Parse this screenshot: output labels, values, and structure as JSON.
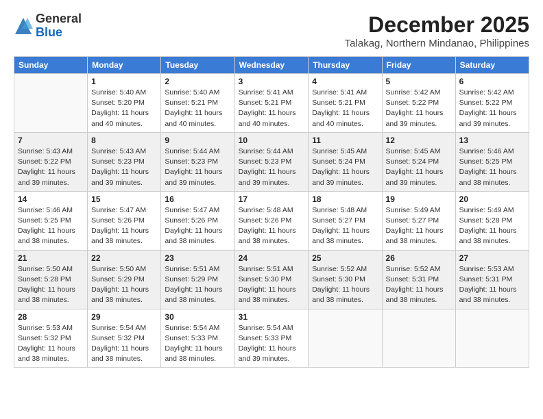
{
  "logo": {
    "general": "General",
    "blue": "Blue"
  },
  "title": {
    "month_year": "December 2025",
    "location": "Talakag, Northern Mindanao, Philippines"
  },
  "headers": [
    "Sunday",
    "Monday",
    "Tuesday",
    "Wednesday",
    "Thursday",
    "Friday",
    "Saturday"
  ],
  "weeks": [
    [
      {
        "day": "",
        "info": ""
      },
      {
        "day": "1",
        "info": "Sunrise: 5:40 AM\nSunset: 5:20 PM\nDaylight: 11 hours\nand 40 minutes."
      },
      {
        "day": "2",
        "info": "Sunrise: 5:40 AM\nSunset: 5:21 PM\nDaylight: 11 hours\nand 40 minutes."
      },
      {
        "day": "3",
        "info": "Sunrise: 5:41 AM\nSunset: 5:21 PM\nDaylight: 11 hours\nand 40 minutes."
      },
      {
        "day": "4",
        "info": "Sunrise: 5:41 AM\nSunset: 5:21 PM\nDaylight: 11 hours\nand 40 minutes."
      },
      {
        "day": "5",
        "info": "Sunrise: 5:42 AM\nSunset: 5:22 PM\nDaylight: 11 hours\nand 39 minutes."
      },
      {
        "day": "6",
        "info": "Sunrise: 5:42 AM\nSunset: 5:22 PM\nDaylight: 11 hours\nand 39 minutes."
      }
    ],
    [
      {
        "day": "7",
        "info": "Sunrise: 5:43 AM\nSunset: 5:22 PM\nDaylight: 11 hours\nand 39 minutes."
      },
      {
        "day": "8",
        "info": "Sunrise: 5:43 AM\nSunset: 5:23 PM\nDaylight: 11 hours\nand 39 minutes."
      },
      {
        "day": "9",
        "info": "Sunrise: 5:44 AM\nSunset: 5:23 PM\nDaylight: 11 hours\nand 39 minutes."
      },
      {
        "day": "10",
        "info": "Sunrise: 5:44 AM\nSunset: 5:23 PM\nDaylight: 11 hours\nand 39 minutes."
      },
      {
        "day": "11",
        "info": "Sunrise: 5:45 AM\nSunset: 5:24 PM\nDaylight: 11 hours\nand 39 minutes."
      },
      {
        "day": "12",
        "info": "Sunrise: 5:45 AM\nSunset: 5:24 PM\nDaylight: 11 hours\nand 39 minutes."
      },
      {
        "day": "13",
        "info": "Sunrise: 5:46 AM\nSunset: 5:25 PM\nDaylight: 11 hours\nand 38 minutes."
      }
    ],
    [
      {
        "day": "14",
        "info": "Sunrise: 5:46 AM\nSunset: 5:25 PM\nDaylight: 11 hours\nand 38 minutes."
      },
      {
        "day": "15",
        "info": "Sunrise: 5:47 AM\nSunset: 5:26 PM\nDaylight: 11 hours\nand 38 minutes."
      },
      {
        "day": "16",
        "info": "Sunrise: 5:47 AM\nSunset: 5:26 PM\nDaylight: 11 hours\nand 38 minutes."
      },
      {
        "day": "17",
        "info": "Sunrise: 5:48 AM\nSunset: 5:26 PM\nDaylight: 11 hours\nand 38 minutes."
      },
      {
        "day": "18",
        "info": "Sunrise: 5:48 AM\nSunset: 5:27 PM\nDaylight: 11 hours\nand 38 minutes."
      },
      {
        "day": "19",
        "info": "Sunrise: 5:49 AM\nSunset: 5:27 PM\nDaylight: 11 hours\nand 38 minutes."
      },
      {
        "day": "20",
        "info": "Sunrise: 5:49 AM\nSunset: 5:28 PM\nDaylight: 11 hours\nand 38 minutes."
      }
    ],
    [
      {
        "day": "21",
        "info": "Sunrise: 5:50 AM\nSunset: 5:28 PM\nDaylight: 11 hours\nand 38 minutes."
      },
      {
        "day": "22",
        "info": "Sunrise: 5:50 AM\nSunset: 5:29 PM\nDaylight: 11 hours\nand 38 minutes."
      },
      {
        "day": "23",
        "info": "Sunrise: 5:51 AM\nSunset: 5:29 PM\nDaylight: 11 hours\nand 38 minutes."
      },
      {
        "day": "24",
        "info": "Sunrise: 5:51 AM\nSunset: 5:30 PM\nDaylight: 11 hours\nand 38 minutes."
      },
      {
        "day": "25",
        "info": "Sunrise: 5:52 AM\nSunset: 5:30 PM\nDaylight: 11 hours\nand 38 minutes."
      },
      {
        "day": "26",
        "info": "Sunrise: 5:52 AM\nSunset: 5:31 PM\nDaylight: 11 hours\nand 38 minutes."
      },
      {
        "day": "27",
        "info": "Sunrise: 5:53 AM\nSunset: 5:31 PM\nDaylight: 11 hours\nand 38 minutes."
      }
    ],
    [
      {
        "day": "28",
        "info": "Sunrise: 5:53 AM\nSunset: 5:32 PM\nDaylight: 11 hours\nand 38 minutes."
      },
      {
        "day": "29",
        "info": "Sunrise: 5:54 AM\nSunset: 5:32 PM\nDaylight: 11 hours\nand 38 minutes."
      },
      {
        "day": "30",
        "info": "Sunrise: 5:54 AM\nSunset: 5:33 PM\nDaylight: 11 hours\nand 38 minutes."
      },
      {
        "day": "31",
        "info": "Sunrise: 5:54 AM\nSunset: 5:33 PM\nDaylight: 11 hours\nand 39 minutes."
      },
      {
        "day": "",
        "info": ""
      },
      {
        "day": "",
        "info": ""
      },
      {
        "day": "",
        "info": ""
      }
    ]
  ]
}
